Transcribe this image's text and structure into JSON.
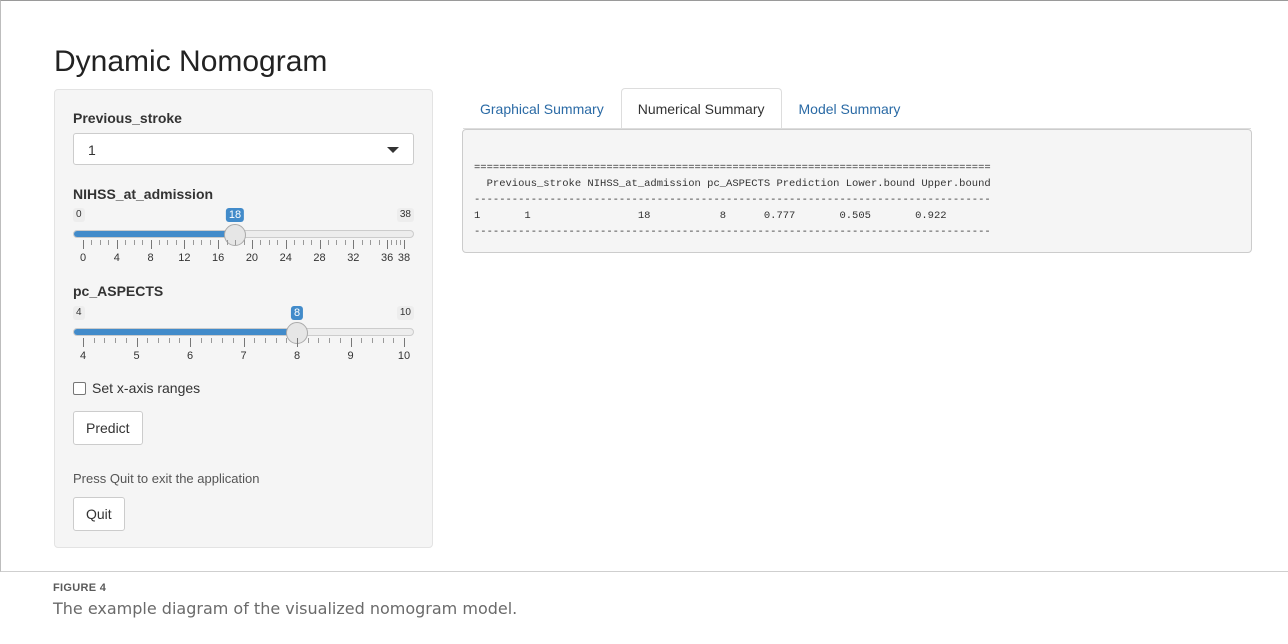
{
  "app": {
    "title": "Dynamic Nomogram"
  },
  "sidebar": {
    "previous_stroke": {
      "label": "Previous_stroke",
      "selected": "1"
    },
    "nihss": {
      "label": "NIHSS_at_admission",
      "min": 0,
      "max": 38,
      "value": 18,
      "min_label": "0",
      "max_label": "38",
      "value_label": "18",
      "tick_labels": [
        "0",
        "4",
        "8",
        "12",
        "16",
        "20",
        "24",
        "28",
        "32",
        "36",
        "38"
      ]
    },
    "aspects": {
      "label": "pc_ASPECTS",
      "min": 4,
      "max": 10,
      "value": 8,
      "min_label": "4",
      "max_label": "10",
      "value_label": "8",
      "tick_labels": [
        "4",
        "5",
        "6",
        "7",
        "8",
        "9",
        "10"
      ]
    },
    "checkbox_label": "Set x-axis ranges",
    "predict_button": "Predict",
    "help_text": "Press Quit to exit the application",
    "quit_button": "Quit"
  },
  "tabs": [
    {
      "label": "Graphical Summary",
      "active": false
    },
    {
      "label": "Numerical Summary",
      "active": true
    },
    {
      "label": "Model Summary",
      "active": false
    }
  ],
  "output": {
    "rule_double": "==================================================================================",
    "header": "  Previous_stroke NIHSS_at_admission pc_ASPECTS Prediction Lower.bound Upper.bound",
    "rule_single": "----------------------------------------------------------------------------------",
    "row": "1       1                 18           8      0.777       0.505       0.922"
  },
  "caption": {
    "label": "FIGURE 4",
    "text": "The example diagram of the visualized nomogram model."
  },
  "colors": {
    "accent": "#428bca",
    "link": "#2a6aa5",
    "panel": "#f5f5f5"
  }
}
